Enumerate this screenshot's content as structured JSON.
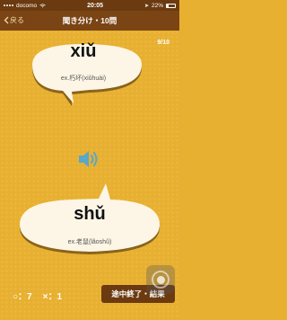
{
  "status_bar": {
    "carrier": "docomo",
    "time": "20:05",
    "battery": "22%"
  },
  "nav": {
    "back_label": "戻る",
    "title": "聞き分け・10問"
  },
  "progress": "9/10",
  "question": {
    "pinyin": "xiǔ",
    "example": "ex.朽坏(xiǔhuài)"
  },
  "answer": {
    "pinyin": "shǔ",
    "example": "ex.老鼠(lǎoshǔ)"
  },
  "score": {
    "correct": "○：7",
    "wrong": "×：1"
  },
  "quit_label": "途中終了・結果",
  "icons": {
    "back": "chevron-left-icon",
    "speaker": "speaker-icon",
    "signal": "signal-icon",
    "wifi": "wifi-icon",
    "battery": "battery-icon"
  },
  "colors": {
    "background": "#e8b030",
    "nav": "#7a4414",
    "bubble": "#fdf6e6",
    "speaker": "#5aa7c8",
    "button": "#6b3a10"
  }
}
